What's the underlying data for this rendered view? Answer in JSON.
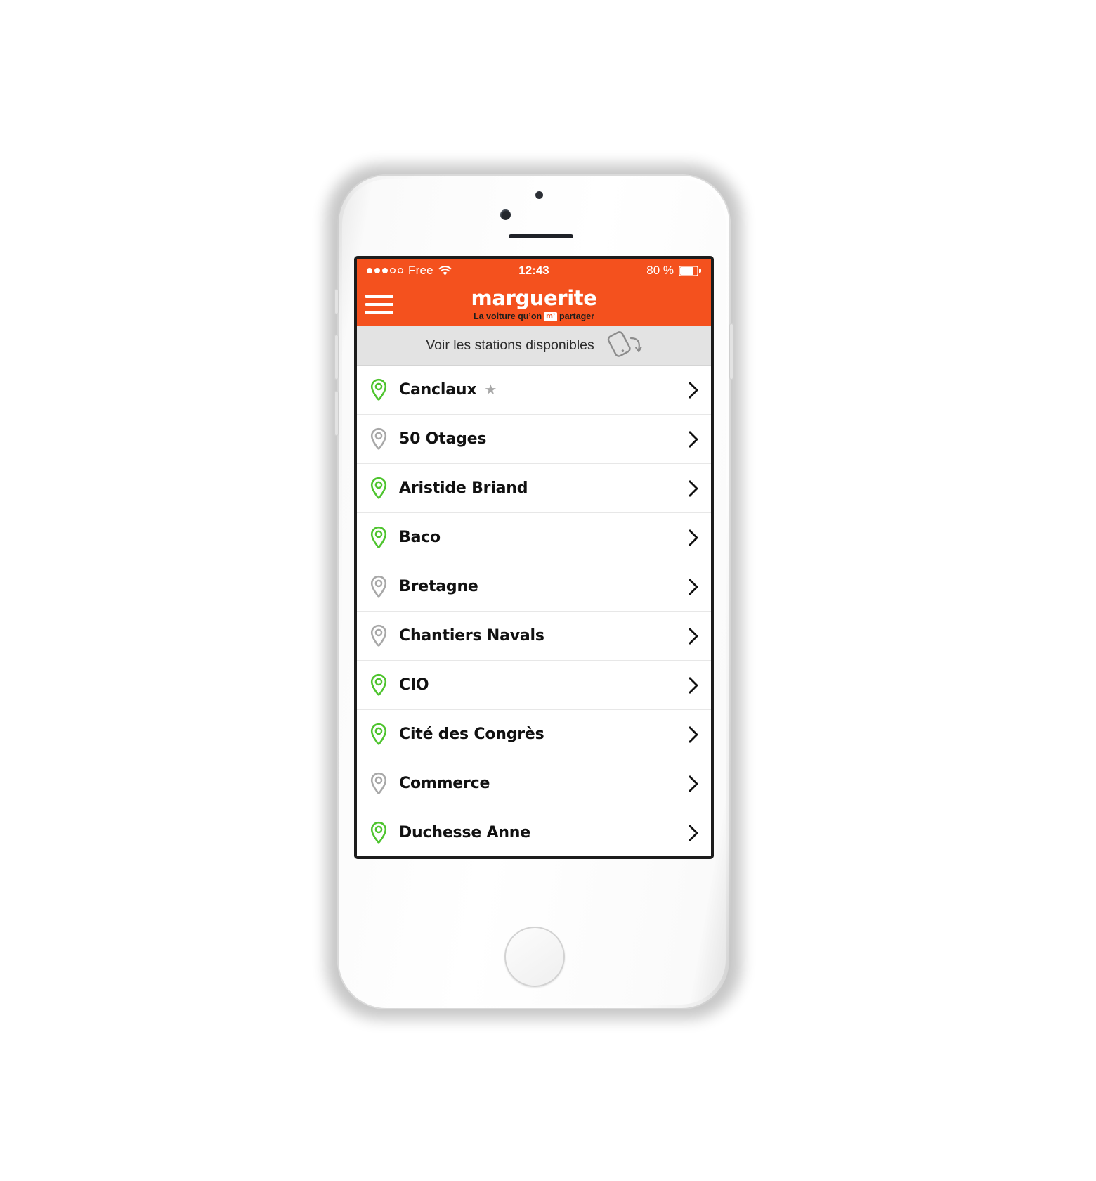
{
  "status_bar": {
    "signal_dots_filled": 3,
    "signal_dots_empty": 2,
    "carrier": "Free",
    "wifi_icon": "wifi-icon",
    "time": "12:43",
    "battery_percent": "80 %",
    "battery_level": 80
  },
  "app_bar": {
    "menu_icon": "hamburger-menu-icon",
    "brand_name": "marguerite",
    "tagline_before": "La voiture qu’on",
    "tagline_badge": "m’",
    "tagline_after": "partager"
  },
  "rotate_banner": {
    "label": "Voir les stations disponibles",
    "icon": "rotate-device-icon"
  },
  "colors": {
    "brand_orange": "#f4511e",
    "available_green": "#4ec42e",
    "unavailable_grey": "#a8a8a8",
    "banner_grey": "#e3e3e3",
    "text_dark": "#111111"
  },
  "stations": [
    {
      "name": "Canclaux",
      "available": true,
      "favorite": true,
      "star": "★"
    },
    {
      "name": "50 Otages",
      "available": false,
      "favorite": false,
      "star": ""
    },
    {
      "name": "Aristide Briand",
      "available": true,
      "favorite": false,
      "star": ""
    },
    {
      "name": "Baco",
      "available": true,
      "favorite": false,
      "star": ""
    },
    {
      "name": "Bretagne",
      "available": false,
      "favorite": false,
      "star": ""
    },
    {
      "name": "Chantiers Navals",
      "available": false,
      "favorite": false,
      "star": ""
    },
    {
      "name": "CIO",
      "available": true,
      "favorite": false,
      "star": ""
    },
    {
      "name": "Cité des Congrès",
      "available": true,
      "favorite": false,
      "star": ""
    },
    {
      "name": "Commerce",
      "available": false,
      "favorite": false,
      "star": ""
    },
    {
      "name": "Duchesse Anne",
      "available": true,
      "favorite": false,
      "star": ""
    }
  ]
}
